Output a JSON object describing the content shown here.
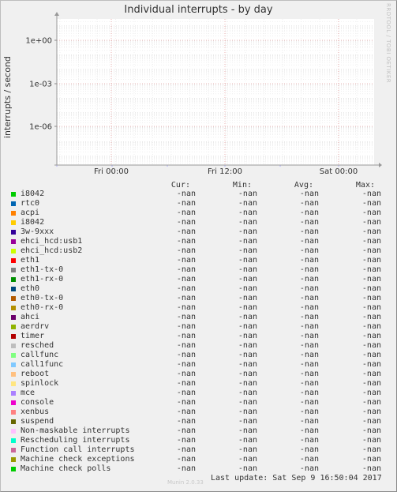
{
  "title": "Individual interrupts - by day",
  "ylabel": "interrupts / second",
  "vertical_text": "RRDTOOL / TOBI OETIKER",
  "watermark": "Munin 2.0.33",
  "columns": [
    "Cur:",
    "Min:",
    "Avg:",
    "Max:"
  ],
  "footer": {
    "label": "Last update:",
    "value": "Sat Sep  9 16:50:04 2017"
  },
  "colors": {
    "background": "#f0f0f0",
    "plot_bg": "#ffffff",
    "grid_major": "#e8a0a0",
    "grid_minor": "#dddddd"
  },
  "chart_data": {
    "type": "line",
    "title": "Individual interrupts - by day",
    "ylabel": "interrupts / second",
    "y_scale": "log",
    "yticks": [
      "1e+00",
      "1e-03",
      "1e-06"
    ],
    "xticks": [
      "Fri 00:00",
      "Fri 12:00",
      "Sat 00:00"
    ],
    "grid": true,
    "legend_placement": "bottom",
    "series": [
      {
        "name": "i8042",
        "color": "#00cc00",
        "cur": "-nan",
        "min": "-nan",
        "avg": "-nan",
        "max": "-nan"
      },
      {
        "name": "rtc0",
        "color": "#0066b3",
        "cur": "-nan",
        "min": "-nan",
        "avg": "-nan",
        "max": "-nan"
      },
      {
        "name": "acpi",
        "color": "#ff8000",
        "cur": "-nan",
        "min": "-nan",
        "avg": "-nan",
        "max": "-nan"
      },
      {
        "name": "i8042",
        "color": "#ffcc00",
        "cur": "-nan",
        "min": "-nan",
        "avg": "-nan",
        "max": "-nan"
      },
      {
        "name": "3w-9xxx",
        "color": "#330099",
        "cur": "-nan",
        "min": "-nan",
        "avg": "-nan",
        "max": "-nan"
      },
      {
        "name": "ehci_hcd:usb1",
        "color": "#990099",
        "cur": "-nan",
        "min": "-nan",
        "avg": "-nan",
        "max": "-nan"
      },
      {
        "name": "ehci_hcd:usb2",
        "color": "#ccff00",
        "cur": "-nan",
        "min": "-nan",
        "avg": "-nan",
        "max": "-nan"
      },
      {
        "name": "eth1",
        "color": "#ff0000",
        "cur": "-nan",
        "min": "-nan",
        "avg": "-nan",
        "max": "-nan"
      },
      {
        "name": "eth1-tx-0",
        "color": "#808080",
        "cur": "-nan",
        "min": "-nan",
        "avg": "-nan",
        "max": "-nan"
      },
      {
        "name": "eth1-rx-0",
        "color": "#008f00",
        "cur": "-nan",
        "min": "-nan",
        "avg": "-nan",
        "max": "-nan"
      },
      {
        "name": "eth0",
        "color": "#00487d",
        "cur": "-nan",
        "min": "-nan",
        "avg": "-nan",
        "max": "-nan"
      },
      {
        "name": "eth0-tx-0",
        "color": "#b35a00",
        "cur": "-nan",
        "min": "-nan",
        "avg": "-nan",
        "max": "-nan"
      },
      {
        "name": "eth0-rx-0",
        "color": "#b38f00",
        "cur": "-nan",
        "min": "-nan",
        "avg": "-nan",
        "max": "-nan"
      },
      {
        "name": "ahci",
        "color": "#6b006b",
        "cur": "-nan",
        "min": "-nan",
        "avg": "-nan",
        "max": "-nan"
      },
      {
        "name": "aerdrv",
        "color": "#8fb300",
        "cur": "-nan",
        "min": "-nan",
        "avg": "-nan",
        "max": "-nan"
      },
      {
        "name": "timer",
        "color": "#b30000",
        "cur": "-nan",
        "min": "-nan",
        "avg": "-nan",
        "max": "-nan"
      },
      {
        "name": "resched",
        "color": "#bebebe",
        "cur": "-nan",
        "min": "-nan",
        "avg": "-nan",
        "max": "-nan"
      },
      {
        "name": "callfunc",
        "color": "#80ff80",
        "cur": "-nan",
        "min": "-nan",
        "avg": "-nan",
        "max": "-nan"
      },
      {
        "name": "call1func",
        "color": "#80c9ff",
        "cur": "-nan",
        "min": "-nan",
        "avg": "-nan",
        "max": "-nan"
      },
      {
        "name": "reboot",
        "color": "#ffc080",
        "cur": "-nan",
        "min": "-nan",
        "avg": "-nan",
        "max": "-nan"
      },
      {
        "name": "spinlock",
        "color": "#ffe680",
        "cur": "-nan",
        "min": "-nan",
        "avg": "-nan",
        "max": "-nan"
      },
      {
        "name": "mce",
        "color": "#aa80ff",
        "cur": "-nan",
        "min": "-nan",
        "avg": "-nan",
        "max": "-nan"
      },
      {
        "name": "console",
        "color": "#ee00cc",
        "cur": "-nan",
        "min": "-nan",
        "avg": "-nan",
        "max": "-nan"
      },
      {
        "name": "xenbus",
        "color": "#ff8080",
        "cur": "-nan",
        "min": "-nan",
        "avg": "-nan",
        "max": "-nan"
      },
      {
        "name": "suspend",
        "color": "#666600",
        "cur": "-nan",
        "min": "-nan",
        "avg": "-nan",
        "max": "-nan"
      },
      {
        "name": "Non-maskable interrupts",
        "color": "#ffbfff",
        "cur": "-nan",
        "min": "-nan",
        "avg": "-nan",
        "max": "-nan"
      },
      {
        "name": "Rescheduling interrupts",
        "color": "#00ffcc",
        "cur": "-nan",
        "min": "-nan",
        "avg": "-nan",
        "max": "-nan"
      },
      {
        "name": "Function call interrupts",
        "color": "#cc6699",
        "cur": "-nan",
        "min": "-nan",
        "avg": "-nan",
        "max": "-nan"
      },
      {
        "name": "Machine check exceptions",
        "color": "#999900",
        "cur": "-nan",
        "min": "-nan",
        "avg": "-nan",
        "max": "-nan"
      },
      {
        "name": "Machine check polls",
        "color": "#00cc00",
        "cur": "-nan",
        "min": "-nan",
        "avg": "-nan",
        "max": "-nan"
      }
    ]
  }
}
